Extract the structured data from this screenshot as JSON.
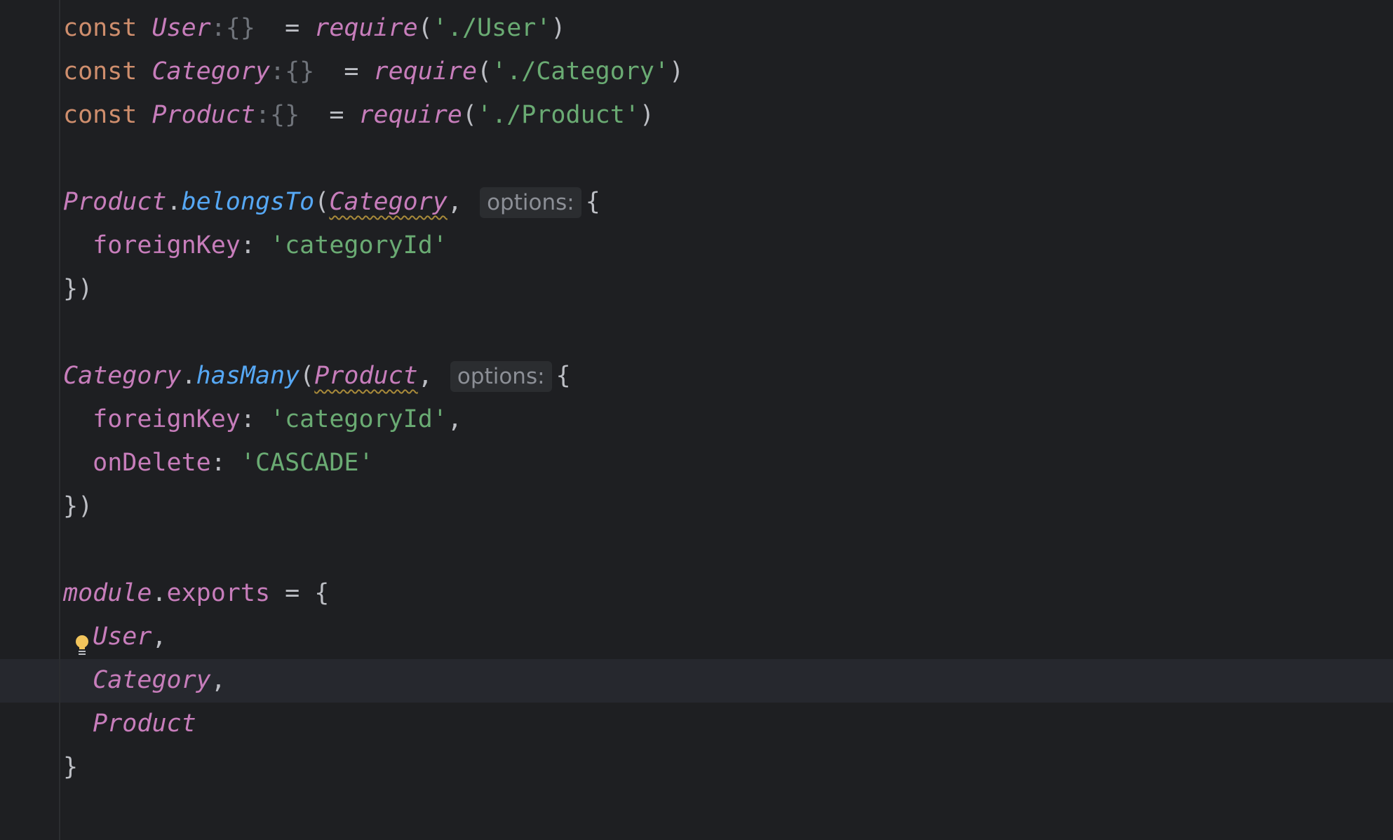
{
  "editor": {
    "colors": {
      "background": "#1e1f22",
      "keyword": "#cf8e6d",
      "identifier": "#c77dbb",
      "function": "#56a8f5",
      "string": "#6aab73",
      "text": "#bcbec4",
      "current_line": "#26282e"
    },
    "current_line_index": 15,
    "bulb_line_index": 14,
    "lines": [
      [
        {
          "t": "const",
          "c": "kw"
        },
        {
          "t": " "
        },
        {
          "t": "User",
          "c": "id"
        },
        {
          "t": ":{}",
          "c": "type"
        },
        {
          "t": "  = "
        },
        {
          "t": "require",
          "c": "id"
        },
        {
          "t": "("
        },
        {
          "t": "'./User'",
          "c": "str"
        },
        {
          "t": ")"
        }
      ],
      [
        {
          "t": "const",
          "c": "kw"
        },
        {
          "t": " "
        },
        {
          "t": "Category",
          "c": "id"
        },
        {
          "t": ":{}",
          "c": "type"
        },
        {
          "t": "  = "
        },
        {
          "t": "require",
          "c": "id"
        },
        {
          "t": "("
        },
        {
          "t": "'./Category'",
          "c": "str"
        },
        {
          "t": ")"
        }
      ],
      [
        {
          "t": "const",
          "c": "kw"
        },
        {
          "t": " "
        },
        {
          "t": "Product",
          "c": "id"
        },
        {
          "t": ":{}",
          "c": "type"
        },
        {
          "t": "  = "
        },
        {
          "t": "require",
          "c": "id"
        },
        {
          "t": "("
        },
        {
          "t": "'./Product'",
          "c": "str"
        },
        {
          "t": ")"
        }
      ],
      [],
      [
        {
          "t": "Product",
          "c": "id"
        },
        {
          "t": "."
        },
        {
          "t": "belongsTo",
          "c": "fn"
        },
        {
          "t": "("
        },
        {
          "t": "Category",
          "c": "id warn"
        },
        {
          "t": ", "
        },
        {
          "t": "options:",
          "c": "hint"
        },
        {
          "t": "{"
        }
      ],
      [
        {
          "t": "  "
        },
        {
          "t": "foreignKey",
          "c": "prop"
        },
        {
          "t": ": "
        },
        {
          "t": "'categoryId'",
          "c": "str"
        }
      ],
      [
        {
          "t": "})"
        }
      ],
      [],
      [
        {
          "t": "Category",
          "c": "id"
        },
        {
          "t": "."
        },
        {
          "t": "hasMany",
          "c": "fn"
        },
        {
          "t": "("
        },
        {
          "t": "Product",
          "c": "id warn"
        },
        {
          "t": ", "
        },
        {
          "t": "options:",
          "c": "hint"
        },
        {
          "t": "{"
        }
      ],
      [
        {
          "t": "  "
        },
        {
          "t": "foreignKey",
          "c": "prop"
        },
        {
          "t": ": "
        },
        {
          "t": "'categoryId'",
          "c": "str"
        },
        {
          "t": ","
        }
      ],
      [
        {
          "t": "  "
        },
        {
          "t": "onDelete",
          "c": "prop"
        },
        {
          "t": ": "
        },
        {
          "t": "'CASCADE'",
          "c": "str"
        }
      ],
      [
        {
          "t": "})"
        }
      ],
      [],
      [
        {
          "t": "module",
          "c": "id"
        },
        {
          "t": "."
        },
        {
          "t": "exports",
          "c": "prop"
        },
        {
          "t": " = {"
        }
      ],
      [
        {
          "t": "  "
        },
        {
          "t": "User",
          "c": "id"
        },
        {
          "t": ","
        }
      ],
      [
        {
          "t": "  "
        },
        {
          "t": "Category",
          "c": "id"
        },
        {
          "t": ","
        }
      ],
      [
        {
          "t": "  "
        },
        {
          "t": "Product",
          "c": "id"
        }
      ],
      [
        {
          "t": "}"
        }
      ]
    ]
  }
}
